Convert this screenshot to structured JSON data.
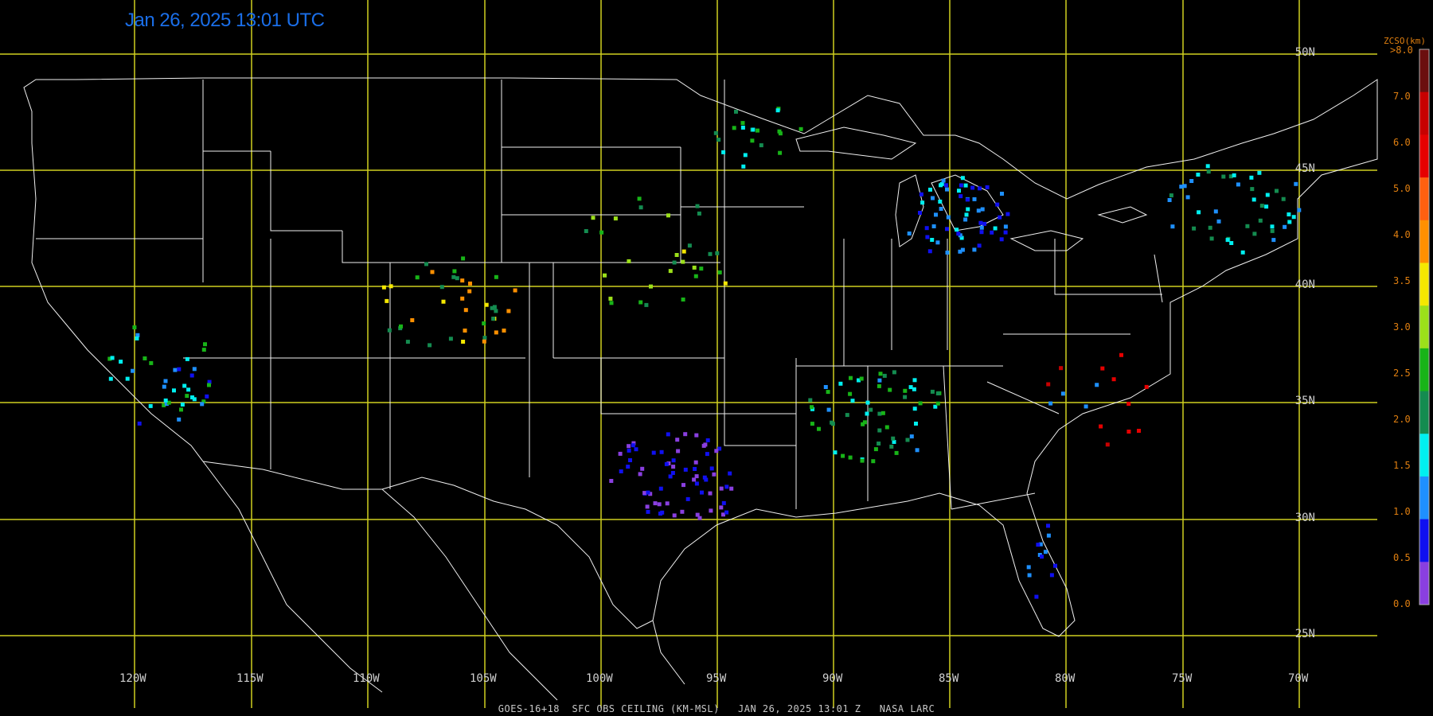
{
  "timestamp": "Jan 26, 2025 13:01 UTC",
  "footer": "GOES-16+18  SFC OBS CEILING (KM-MSL)   JAN 26, 2025 13:01 Z   NASA LARC",
  "lat_labels": [
    "50N",
    "45N",
    "40N",
    "35N",
    "30N",
    "25N"
  ],
  "lon_labels": [
    "120W",
    "115W",
    "110W",
    "105W",
    "100W",
    "95W",
    "90W",
    "85W",
    "80W",
    "75W",
    "70W"
  ],
  "legend": {
    "title": "ZCSO(km)",
    "ticks": [
      ">8.0",
      "7.0",
      "6.0",
      "5.0",
      "4.0",
      "3.5",
      "3.0",
      "2.5",
      "2.0",
      "1.5",
      "1.0",
      "0.5",
      "0.0"
    ],
    "colors": [
      "#6b0f0f",
      "#c80000",
      "#e60000",
      "#ff6010",
      "#ff9000",
      "#f5e800",
      "#9ce01a",
      "#18b418",
      "#148c50",
      "#00f0f0",
      "#1e90ff",
      "#1010f0",
      "#8a3fe0"
    ]
  },
  "colors": {
    "grid": "#cfcf20",
    "boundaries": "#f0f0f0",
    "timestamp": "#1a6ee8"
  }
}
